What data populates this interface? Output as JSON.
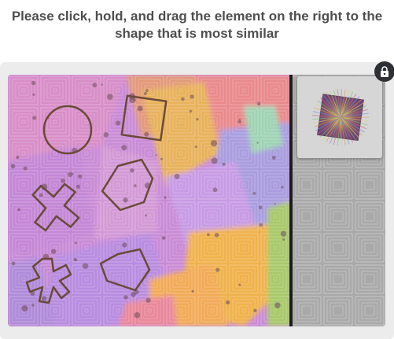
{
  "instruction": {
    "line1": "Please click, hold, and drag the element on the right to the",
    "line2": "shape that is most similar"
  },
  "lock_icon": "lock-icon",
  "colors": {
    "lock_bg": "#2f3035",
    "shape_stroke": "#6a4a38",
    "divider": "#1c1c1c"
  },
  "targets": [
    "circle",
    "square",
    "hexagon",
    "cross",
    "asterisk-star",
    "pentagon"
  ],
  "piece": {
    "shape": "square",
    "style": "radial-color-burst"
  }
}
